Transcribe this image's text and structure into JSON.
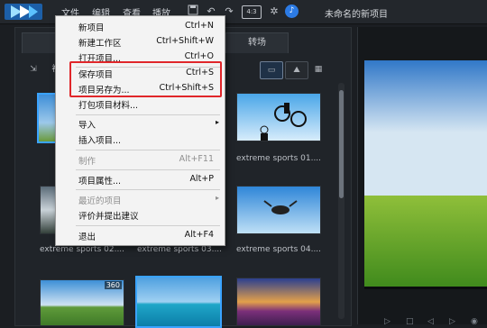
{
  "app": {
    "project_title": "未命名的新项目"
  },
  "menubar": {
    "items": [
      "文件",
      "编辑",
      "查看",
      "播放"
    ]
  },
  "toolbar": {
    "aspect_ratio": "4:3"
  },
  "library": {
    "tab_transitions": "转场",
    "thumbnails": [
      {
        "caption": "",
        "selected": true,
        "badge": ""
      },
      {
        "caption": "",
        "selected": false,
        "badge": ""
      },
      {
        "caption": "extreme sports 01....",
        "selected": false,
        "badge": ""
      },
      {
        "caption": "extreme sports 02....",
        "selected": false,
        "badge": ""
      },
      {
        "caption": "extreme sports 03....",
        "selected": false,
        "badge": ""
      },
      {
        "caption": "extreme sports 04....",
        "selected": false,
        "badge": ""
      },
      {
        "caption": "",
        "selected": false,
        "badge": "360"
      },
      {
        "caption": "",
        "selected": true,
        "badge": ""
      },
      {
        "caption": "",
        "selected": false,
        "badge": ""
      }
    ]
  },
  "file_menu": {
    "items": [
      {
        "label": "新项目",
        "shortcut": "Ctrl+N",
        "disabled": false,
        "submenu": false
      },
      {
        "label": "新建工作区",
        "shortcut": "Ctrl+Shift+W",
        "disabled": false,
        "submenu": false
      },
      {
        "label": "打开项目...",
        "shortcut": "Ctrl+O",
        "disabled": false,
        "submenu": false
      },
      {
        "label": "保存项目",
        "shortcut": "Ctrl+S",
        "disabled": false,
        "submenu": false
      },
      {
        "label": "项目另存为...",
        "shortcut": "Ctrl+Shift+S",
        "disabled": false,
        "submenu": false
      },
      {
        "label": "打包项目材料...",
        "shortcut": "",
        "disabled": false,
        "submenu": false
      },
      {
        "label": "导入",
        "shortcut": "",
        "disabled": false,
        "submenu": true
      },
      {
        "label": "插入项目...",
        "shortcut": "",
        "disabled": false,
        "submenu": false
      },
      {
        "label": "制作",
        "shortcut": "Alt+F11",
        "disabled": true,
        "submenu": false
      },
      {
        "label": "项目属性...",
        "shortcut": "Alt+P",
        "disabled": false,
        "submenu": false
      },
      {
        "label": "最近的项目",
        "shortcut": "",
        "disabled": true,
        "submenu": true
      },
      {
        "label": "评价并提出建议",
        "shortcut": "",
        "disabled": false,
        "submenu": false
      },
      {
        "label": "退出",
        "shortcut": "Alt+F4",
        "disabled": false,
        "submenu": false
      }
    ]
  },
  "colors": {
    "accent": "#3aa3ff",
    "highlight_box": "#e0262a",
    "bell": "#2c7be5"
  }
}
